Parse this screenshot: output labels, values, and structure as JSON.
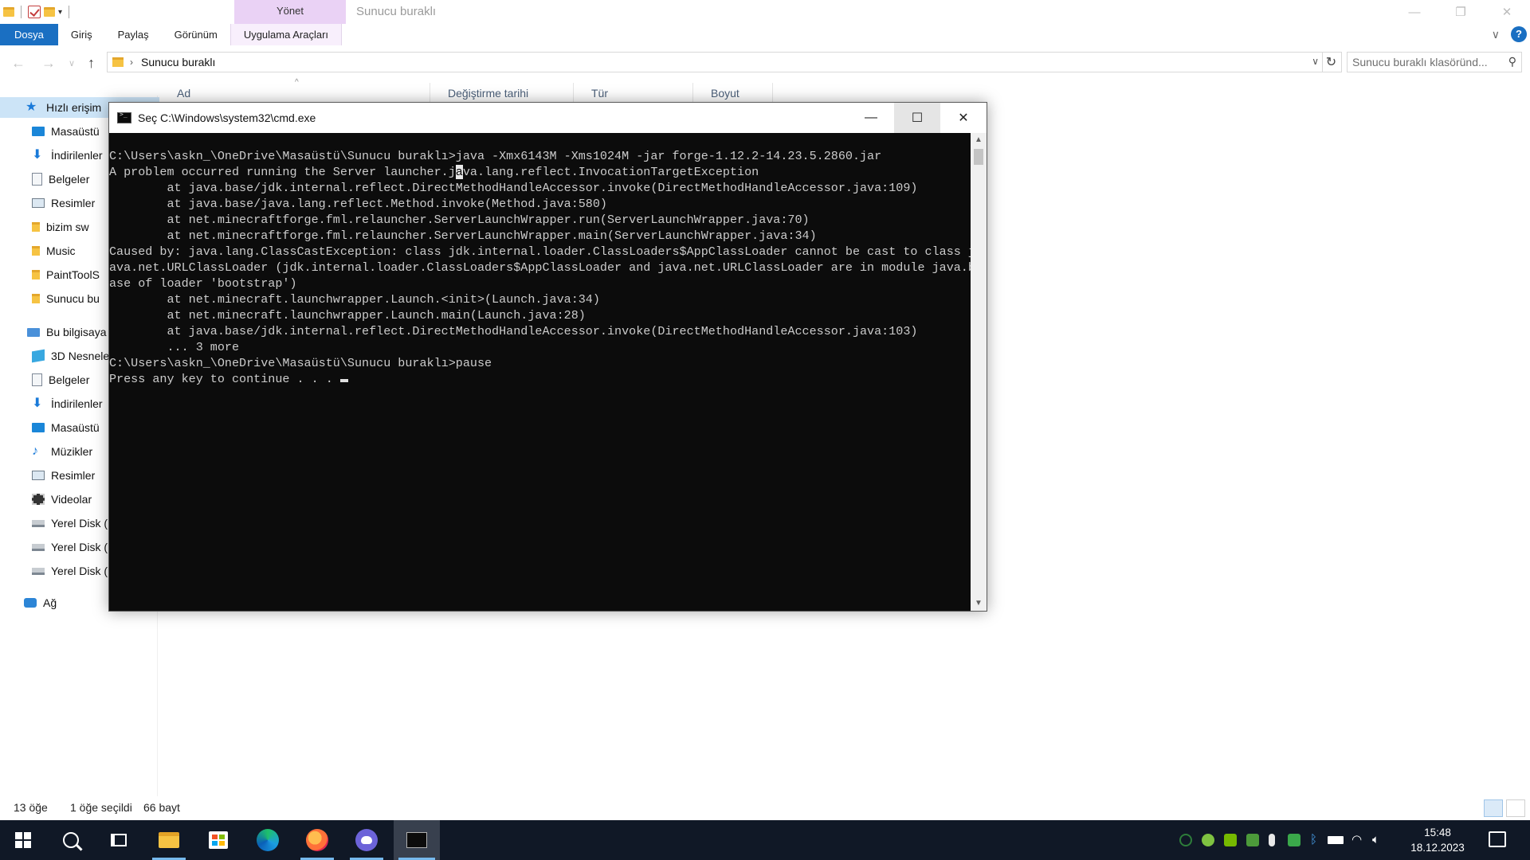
{
  "explorer": {
    "title": "Sunucu buraklı",
    "manage_tab": "Yönet",
    "ribbon_tabs": [
      "Dosya",
      "Giriş",
      "Paylaş",
      "Görünüm",
      "Uygulama Araçları"
    ],
    "address_path": "Sunucu buraklı",
    "search_placeholder": "Sunucu buraklı klasöründ...",
    "columns": [
      "Ad",
      "Değiştirme tarihi",
      "Tür",
      "Boyut"
    ],
    "nav_items": [
      {
        "label": "Hızlı erişim",
        "icon": "star-icon"
      },
      {
        "label": "Masaüstü",
        "icon": "desktop-icon"
      },
      {
        "label": "İndirilenler",
        "icon": "download-icon"
      },
      {
        "label": "Belgeler",
        "icon": "documents-icon"
      },
      {
        "label": "Resimler",
        "icon": "pictures-icon"
      },
      {
        "label": "bizim sw",
        "icon": "folder-icon"
      },
      {
        "label": "Music",
        "icon": "folder-icon"
      },
      {
        "label": "PaintToolS",
        "icon": "folder-icon"
      },
      {
        "label": "Sunucu bu",
        "icon": "folder-icon"
      },
      {
        "label": "Bu bilgisaya",
        "icon": "this-pc-icon"
      },
      {
        "label": "3D Nesnele",
        "icon": "3d-objects-icon"
      },
      {
        "label": "Belgeler",
        "icon": "documents-icon"
      },
      {
        "label": "İndirilenler",
        "icon": "download-icon"
      },
      {
        "label": "Masaüstü",
        "icon": "desktop-icon"
      },
      {
        "label": "Müzikler",
        "icon": "music-icon"
      },
      {
        "label": "Resimler",
        "icon": "pictures-icon"
      },
      {
        "label": "Videolar",
        "icon": "video-icon"
      },
      {
        "label": "Yerel Disk (",
        "icon": "disk-icon"
      },
      {
        "label": "Yerel Disk (",
        "icon": "disk-icon"
      },
      {
        "label": "Yerel Disk (",
        "icon": "disk-icon"
      },
      {
        "label": "Ağ",
        "icon": "network-icon"
      }
    ],
    "status": {
      "count": "13 öğe",
      "selected": "1 öğe seçildi",
      "size": "66 bayt"
    }
  },
  "cmd": {
    "title": "Seç C:\\Windows\\system32\\cmd.exe",
    "lines": [
      "C:\\Users\\askn_\\OneDrive\\Masaüstü\\Sunucu buraklı>java -Xmx6143M -Xms1024M -jar forge-1.12.2-14.23.5.2860.jar",
      "A problem occurred running the Server launcher.java.lang.reflect.InvocationTargetException",
      "        at java.base/jdk.internal.reflect.DirectMethodHandleAccessor.invoke(DirectMethodHandleAccessor.java:109)",
      "        at java.base/java.lang.reflect.Method.invoke(Method.java:580)",
      "        at net.minecraftforge.fml.relauncher.ServerLaunchWrapper.run(ServerLaunchWrapper.java:70)",
      "        at net.minecraftforge.fml.relauncher.ServerLaunchWrapper.main(ServerLaunchWrapper.java:34)",
      "Caused by: java.lang.ClassCastException: class jdk.internal.loader.ClassLoaders$AppClassLoader cannot be cast to class j",
      "ava.net.URLClassLoader (jdk.internal.loader.ClassLoaders$AppClassLoader and java.net.URLClassLoader are in module java.b",
      "ase of loader 'bootstrap')",
      "        at net.minecraft.launchwrapper.Launch.<init>(Launch.java:34)",
      "        at net.minecraft.launchwrapper.Launch.main(Launch.java:28)",
      "        at java.base/jdk.internal.reflect.DirectMethodHandleAccessor.invoke(DirectMethodHandleAccessor.java:103)",
      "        ... 3 more",
      "",
      "C:\\Users\\askn_\\OneDrive\\Masaüstü\\Sunucu buraklı>pause",
      "Press any key to continue . . . "
    ]
  },
  "taskbar": {
    "time": "15:48",
    "date": "18.12.2023",
    "apps": [
      "start-icon",
      "search-icon",
      "task-view-icon",
      "file-explorer-icon",
      "store-icon",
      "edge-icon",
      "firefox-icon",
      "discord-icon",
      "cmd-icon"
    ]
  }
}
